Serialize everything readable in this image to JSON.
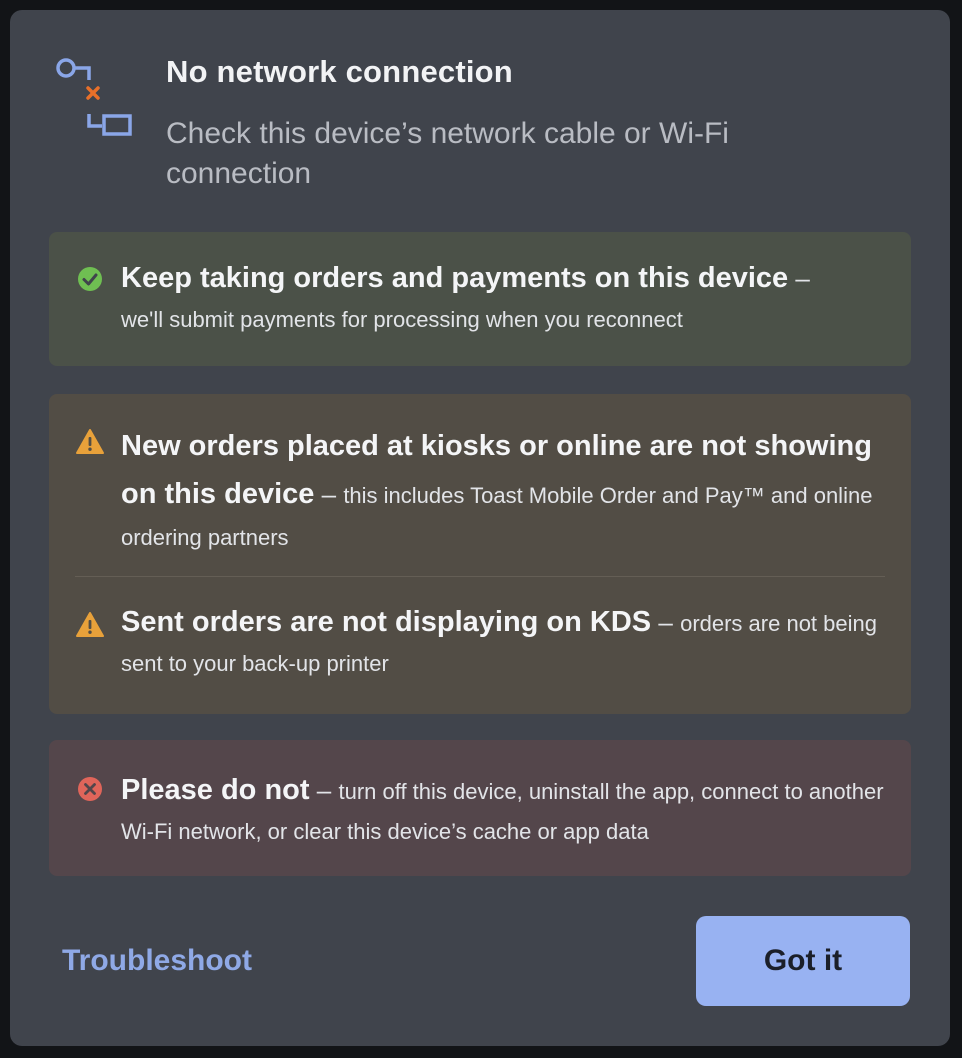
{
  "dialog": {
    "icon": "network-disconnected-icon",
    "title": "No network connection",
    "subtitle": "Check this device’s network cable or Wi-Fi connection"
  },
  "messages": {
    "success": {
      "icon": "check-circle-icon",
      "color": "#6fbf52",
      "heading": "Keep taking orders and payments on this device",
      "dash": " – ",
      "body": "we'll submit payments for processing when you reconnect"
    },
    "warning1": {
      "icon": "warning-triangle-icon",
      "color": "#e8a13a",
      "heading": "New orders placed at kiosks or online are not showing on this device",
      "dash": " – ",
      "body": "this includes Toast Mobile Order and Pay™ and online ordering partners"
    },
    "warning2": {
      "icon": "warning-triangle-icon",
      "color": "#e8a13a",
      "heading": "Sent orders are not displaying on KDS",
      "dash": " – ",
      "body": "orders are not being sent to your back-up printer"
    },
    "error": {
      "icon": "error-circle-icon",
      "color": "#e0655a",
      "heading": "Please do not",
      "dash": " – ",
      "body": "turn off this device, uninstall the app, connect to another Wi-Fi network, or clear this device’s cache or app data"
    }
  },
  "footer": {
    "troubleshoot_label": "Troubleshoot",
    "got_it_label": "Got it"
  }
}
